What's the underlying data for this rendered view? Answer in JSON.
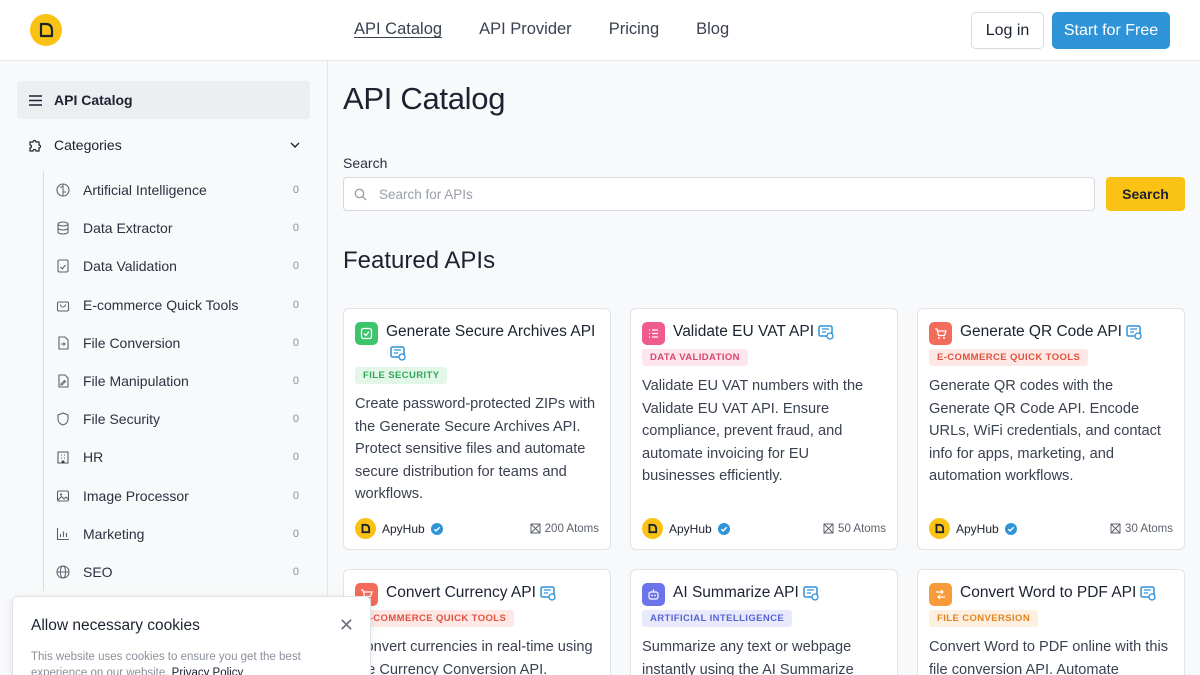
{
  "header": {
    "nav": [
      "API Catalog",
      "API Provider",
      "Pricing",
      "Blog"
    ],
    "login": "Log in",
    "start": "Start for Free"
  },
  "sidebar": {
    "title": "API Catalog",
    "categories_label": "Categories",
    "items": [
      {
        "label": "Artificial Intelligence",
        "count": "0",
        "icon": "brain-icon"
      },
      {
        "label": "Data Extractor",
        "count": "0",
        "icon": "database-icon"
      },
      {
        "label": "Data Validation",
        "count": "0",
        "icon": "document-check-icon"
      },
      {
        "label": "E-commerce Quick Tools",
        "count": "0",
        "icon": "shopping-bag-icon"
      },
      {
        "label": "File Conversion",
        "count": "0",
        "icon": "file-convert-icon"
      },
      {
        "label": "File Manipulation",
        "count": "0",
        "icon": "file-edit-icon"
      },
      {
        "label": "File Security",
        "count": "0",
        "icon": "shield-icon"
      },
      {
        "label": "HR",
        "count": "0",
        "icon": "building-icon"
      },
      {
        "label": "Image Processor",
        "count": "0",
        "icon": "image-icon"
      },
      {
        "label": "Marketing",
        "count": "0",
        "icon": "bar-chart-icon"
      },
      {
        "label": "SEO",
        "count": "0",
        "icon": "globe-icon"
      }
    ]
  },
  "main": {
    "title": "API Catalog",
    "search_label": "Search",
    "search_placeholder": "Search for APIs",
    "search_button": "Search",
    "featured_title": "Featured APIs"
  },
  "cards": [
    {
      "title": "Generate Secure Archives API",
      "tag": "FILE SECURITY",
      "desc": "Create password-protected ZIPs with the Generate Secure Archives API. Protect sensitive files and automate secure distribution for teams and workflows.",
      "provider": "ApyHub",
      "atoms": "200 Atoms",
      "icon_color": "#3ec46d",
      "tag_bg": "#e3f7e8",
      "tag_fg": "#2fa75a"
    },
    {
      "title": "Validate EU VAT API",
      "tag": "DATA VALIDATION",
      "desc": "Validate EU VAT numbers with the Validate EU VAT API. Ensure compliance, prevent fraud, and automate invoicing for EU businesses efficiently.",
      "provider": "ApyHub",
      "atoms": "50 Atoms",
      "icon_color": "#ef5b8c",
      "tag_bg": "#fde6ee",
      "tag_fg": "#d9456f"
    },
    {
      "title": "Generate QR Code API",
      "tag": "E-COMMERCE QUICK TOOLS",
      "desc": "Generate QR codes with the Generate QR Code API. Encode URLs, WiFi credentials, and contact info for apps, marketing, and automation workflows.",
      "provider": "ApyHub",
      "atoms": "30 Atoms",
      "icon_color": "#f26b5b",
      "tag_bg": "#fde8e5",
      "tag_fg": "#e0523f"
    },
    {
      "title": "Convert Currency API",
      "tag": "E-COMMERCE QUICK TOOLS",
      "desc": "Convert currencies in real-time using the Currency Conversion API.",
      "icon_color": "#f26b5b",
      "tag_bg": "#fde8e5",
      "tag_fg": "#e0523f"
    },
    {
      "title": "AI Summarize API",
      "tag": "ARTIFICIAL INTELLIGENCE",
      "desc": "Summarize any text or webpage instantly using the AI Summarize",
      "icon_color": "#6b74e8",
      "tag_bg": "#e8eafc",
      "tag_fg": "#5a62d6"
    },
    {
      "title": "Convert Word to PDF API",
      "tag": "FILE CONVERSION",
      "desc": "Convert Word to PDF online with this file conversion API. Automate",
      "icon_color": "#f79a3a",
      "tag_bg": "#fef0e0",
      "tag_fg": "#e0841f"
    }
  ],
  "cookie": {
    "title": "Allow necessary cookies",
    "text": "This website uses cookies to ensure you get the best experience on our website.",
    "link": "Privacy Policy"
  }
}
